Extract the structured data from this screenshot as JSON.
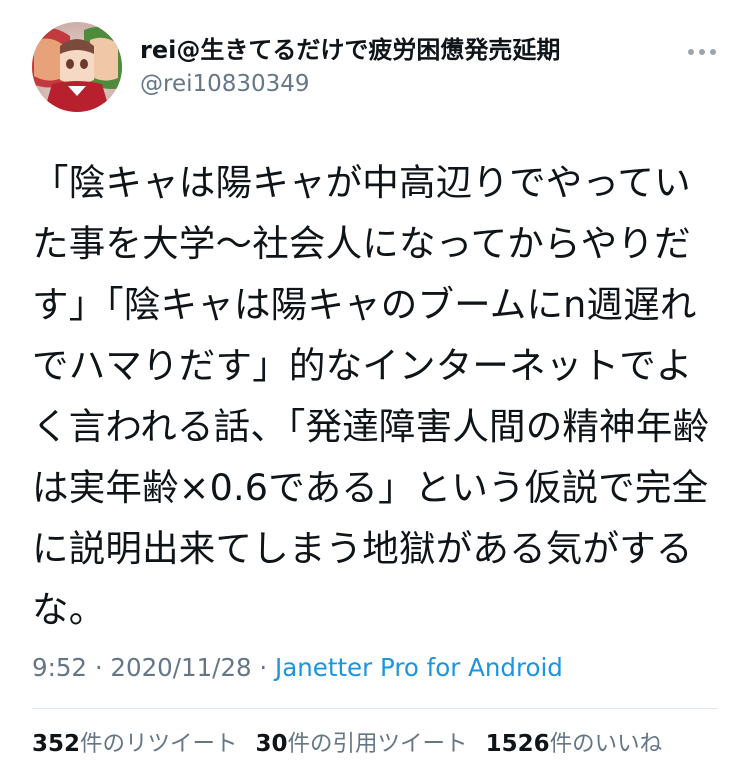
{
  "user": {
    "display_name": "rei@生きてるだけで疲労困憊発売延期",
    "handle": "@rei10830349",
    "avatar_icon": "avatar-image"
  },
  "tweet": {
    "text": "「陰キャは陽キャが中高辺りでやっていた事を大学〜社会人になってからやりだす」「陰キャは陽キャのブームにn週遅れでハマりだす」的なインターネットでよく言われる話、「発達障害人間の精神年齢は実年齢×0.6である」という仮説で完全に説明出来てしまう地獄がある気がするな。"
  },
  "meta": {
    "time": "9:52",
    "separator1": " · ",
    "date": "2020/11/28",
    "separator2": " · ",
    "source": "Janetter Pro for Android"
  },
  "stats": {
    "retweets_count": "352",
    "retweets_label": "件のリツイート",
    "quotes_count": "30",
    "quotes_label": "件の引用ツイート",
    "likes_count": "1526",
    "likes_label": "件のいいね"
  },
  "colors": {
    "text": "#0f1419",
    "secondary": "#657786",
    "link": "#1b95e0",
    "divider": "#e1e8ed"
  },
  "icons": {
    "more": "more-horizontal-icon"
  }
}
